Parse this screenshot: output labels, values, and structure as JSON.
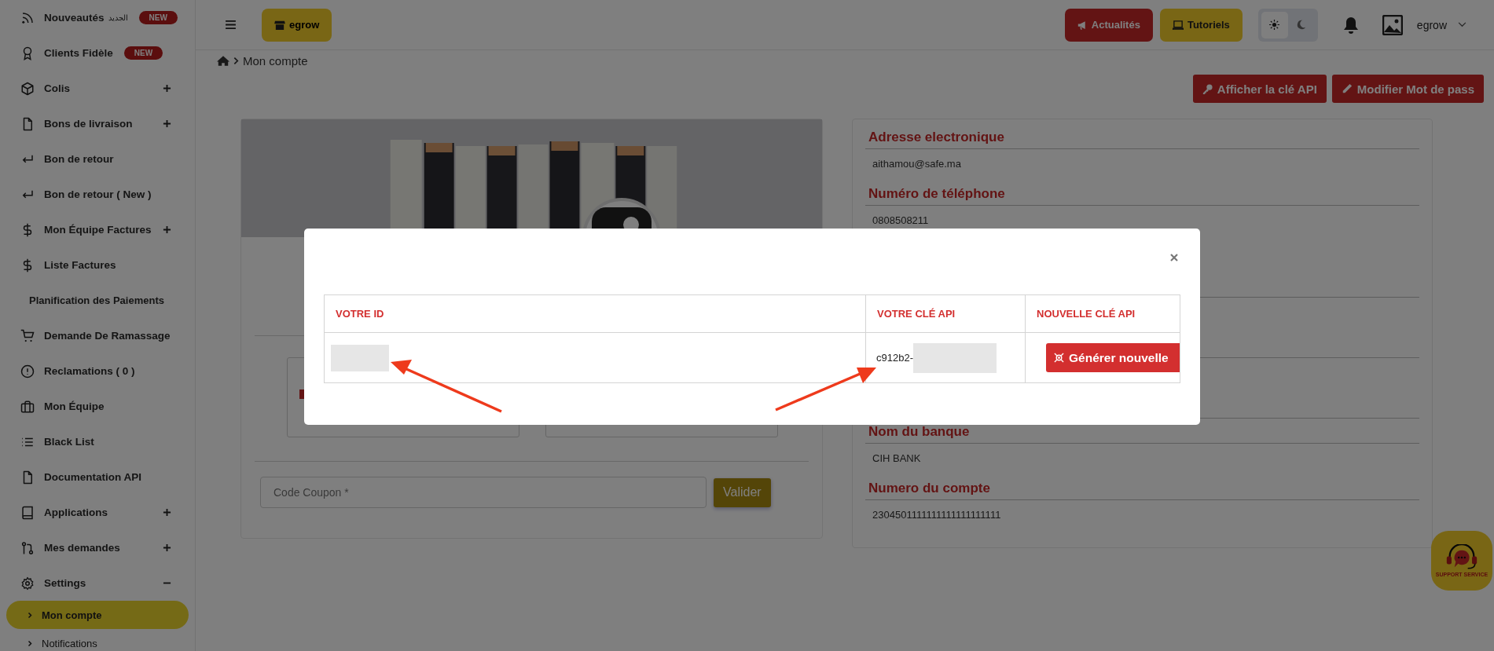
{
  "sidebar": {
    "items": [
      {
        "label": "Nouveautés",
        "tag": "الجديد",
        "badge": "NEW",
        "selected": false
      },
      {
        "label": "Clients Fidèle",
        "badge": "NEW",
        "selected": false
      },
      {
        "label": "Colis",
        "expanded": false,
        "selected": false
      },
      {
        "label": "Bons de livraison",
        "expanded": false,
        "selected": false
      },
      {
        "label": "Bon de retour",
        "selected": false
      },
      {
        "label": "Bon de retour ( New )",
        "selected": false
      },
      {
        "label": "Mon Équipe Factures",
        "expanded": false,
        "selected": false
      },
      {
        "label": "Liste Factures",
        "selected": false
      },
      {
        "label": "Planification des Paiements",
        "selected": false
      },
      {
        "label": "Demande De Ramassage",
        "selected": false
      },
      {
        "label": "Reclamations ( 0 )",
        "selected": false
      },
      {
        "label": "Mon Équipe",
        "selected": false
      },
      {
        "label": "Black List",
        "selected": false
      },
      {
        "label": "Documentation API",
        "selected": false
      },
      {
        "label": "Applications",
        "expanded": false,
        "selected": false
      },
      {
        "label": "Mes demandes",
        "expanded": false,
        "selected": false
      },
      {
        "label": "Settings",
        "expanded": true,
        "selected": false,
        "children": [
          {
            "label": "Mon compte",
            "selected": true
          },
          {
            "label": "Notifications",
            "selected": false
          }
        ]
      }
    ]
  },
  "topbar": {
    "brand": "egrow",
    "buttons": [
      {
        "label": "Actualités",
        "kind": "news"
      },
      {
        "label": "Tutoriels",
        "kind": "tutorials"
      }
    ],
    "theme_toggle": [
      {
        "selected": true
      },
      {
        "selected": false
      }
    ],
    "user": {
      "name": "egrow"
    }
  },
  "breadcrumb": {
    "current": "Mon compte"
  },
  "actions": [
    {
      "label": "Afficher la clé API",
      "kind": "key"
    },
    {
      "label": "Modifier Mot de pass",
      "kind": "edit"
    }
  ],
  "profile_card": {
    "coupon": {
      "placeholder": "Code Coupon *",
      "button": "Valider"
    }
  },
  "details": {
    "fields": [
      {
        "label": "Adresse electronique",
        "value": "aithamou@safe.ma"
      },
      {
        "label": "Numéro de téléphone",
        "value": "0808508211"
      },
      {
        "label": "Nom du banque",
        "value": "CIH BANK"
      },
      {
        "label": "Numero du compte",
        "value": "2304501111111111111111111"
      }
    ]
  },
  "modal": {
    "columns": [
      "VOTRE ID",
      "VOTRE CLÉ API",
      "NOUVELLE CLÉ API"
    ],
    "row": {
      "key_prefix": "c912b2-",
      "button": "Générer nouvelle"
    }
  },
  "support": {
    "caption": "SUPPORT SERVICE"
  }
}
